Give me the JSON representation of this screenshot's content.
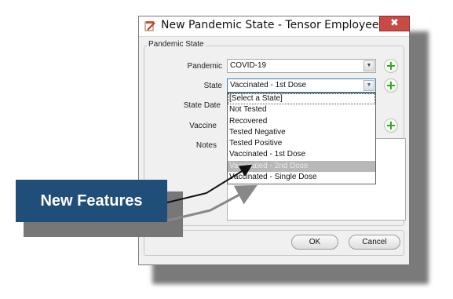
{
  "dialog": {
    "title": "New Pandemic State - Tensor Employee One",
    "close_label": "✖",
    "group_label": "Pandemic State"
  },
  "form": {
    "pandemic_label": "Pandemic",
    "pandemic_value": "COVID-19",
    "state_label": "State",
    "state_value": "Vaccinated - 1st Dose",
    "state_date_label": "State Date",
    "vaccine_label": "Vaccine",
    "notes_label": "Notes"
  },
  "dropdown": {
    "options": [
      "[Select a State]",
      "Not Tested",
      "Recovered",
      "Tested Negative",
      "Tested Positive",
      "Vaccinated - 1st Dose",
      "Vaccinated - 2nd Dose",
      "Vaccinated - Single Dose"
    ],
    "highlighted": "Vaccinated - 2nd Dose"
  },
  "buttons": {
    "ok": "OK",
    "cancel": "Cancel"
  },
  "callout": {
    "text": "New Features"
  },
  "colors": {
    "callout_bg": "#1f4e79",
    "close_bg": "#c74a44",
    "plus_icon": "#33a020",
    "highlight": "#b8b8b8"
  }
}
